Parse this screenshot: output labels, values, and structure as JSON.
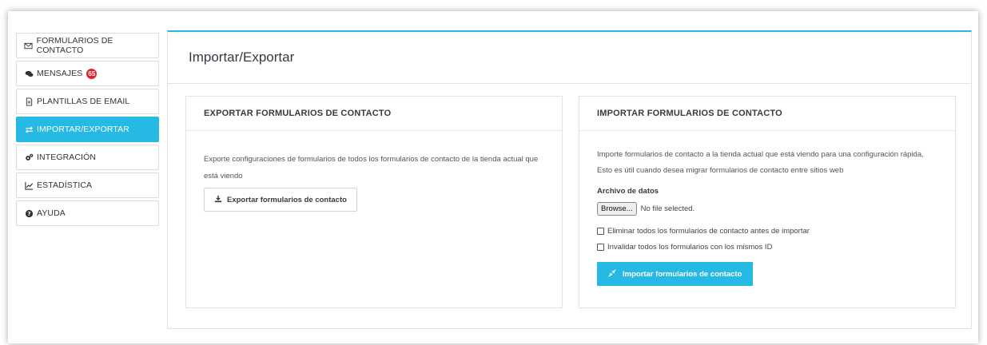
{
  "sidebar": {
    "items": [
      {
        "label": "FORMULARIOS DE CONTACTO",
        "icon": "envelope-icon"
      },
      {
        "label": "MENSAJES",
        "icon": "comments-icon",
        "badge": "65"
      },
      {
        "label": "PLANTILLAS DE EMAIL",
        "icon": "file-icon"
      },
      {
        "label": "IMPORTAR/EXPORTAR",
        "icon": "exchange-icon",
        "active": true
      },
      {
        "label": "INTEGRACIÓN",
        "icon": "cogs-icon"
      },
      {
        "label": "ESTADÍSTICA",
        "icon": "line-chart-icon"
      },
      {
        "label": "AYUDA",
        "icon": "question-circle-icon"
      }
    ]
  },
  "main": {
    "title": "Importar/Exportar"
  },
  "export_card": {
    "title": "EXPORTAR FORMULARIOS DE CONTACTO",
    "description_line1": "Exporte configuraciones de formularios de todos los formularios de contacto de la tienda actual que",
    "description_line2": "está viendo",
    "button_label": "Exportar formularios de contacto"
  },
  "import_card": {
    "title": "IMPORTAR FORMULARIOS DE CONTACTO",
    "description_line1": "Importe formularios de contacto a la tienda actual que está viendo para una configuración rápida.",
    "description_line2": "Esto es útil cuando desea migrar formularios de contacto entre sitios web",
    "file_label": "Archivo de datos",
    "browse_label": "Browse...",
    "no_file_text": "No file selected.",
    "checkbox1_label": "Eliminar todos los formularios de contacto antes de importar",
    "checkbox2_label": "Invalidar todos los formularios con los mismos ID",
    "button_label": "Importar formularios de contacto"
  },
  "colors": {
    "accent": "#25b9e4",
    "badge": "#e8202b"
  }
}
